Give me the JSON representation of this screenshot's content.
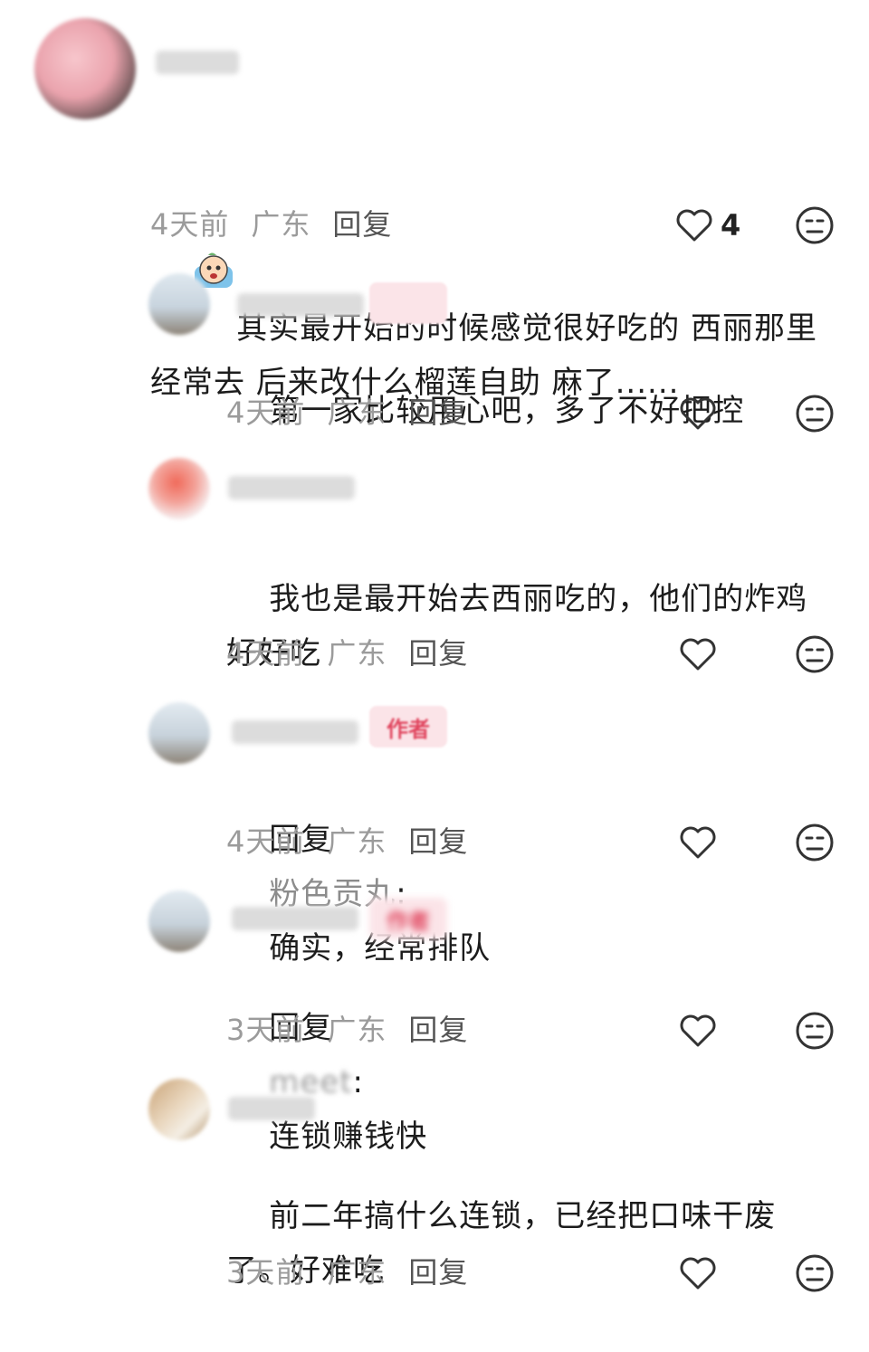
{
  "comments": [
    {
      "text": "其实最开始的时候感觉很好吃的 西丽那里经常去 后来改什么榴莲自助 麻了......",
      "line1": "其实最开始的时候感觉很好吃的 西丽那里",
      "line2": "经常去 后来改什么榴莲自助 麻了......",
      "time": "4天前",
      "location": "广东",
      "reply_label": "回复",
      "likes": "4",
      "emoji_icon": "crying-face-emoji"
    },
    {
      "text": "第一家比较用心吧，多了不好把控",
      "time": "4天前",
      "location": "广东",
      "reply_label": "回复"
    },
    {
      "line1": "我也是最开始去西丽吃的，他们的炸鸡",
      "line2": "好好吃",
      "time": "4天前",
      "location": "广东",
      "reply_label": "回复"
    },
    {
      "author_tag": "作者",
      "reply_prefix": "回复",
      "reply_to": "粉色贡丸",
      "reply_sep": ":",
      "text": "确实，经常排队",
      "time": "4天前",
      "location": "广东",
      "reply_label": "回复"
    },
    {
      "author_tag": "作者",
      "reply_prefix": "回复",
      "reply_to": "meet",
      "reply_sep": ":",
      "text": "连锁赚钱快",
      "time": "3天前",
      "location": "广东",
      "reply_label": "回复"
    },
    {
      "line1": "前二年搞什么连锁，已经把口味干废",
      "line2": "了。好难吃",
      "time": "3天前",
      "location": "广东",
      "reply_label": "回复"
    }
  ],
  "icons": {
    "like": "heart-outline-icon",
    "dislike": "neutral-face-icon"
  },
  "colors": {
    "text": "#1c1c1c",
    "meta": "#9b9b9b",
    "tag": "#e0455e",
    "tag_bg": "#fbe4e8"
  }
}
